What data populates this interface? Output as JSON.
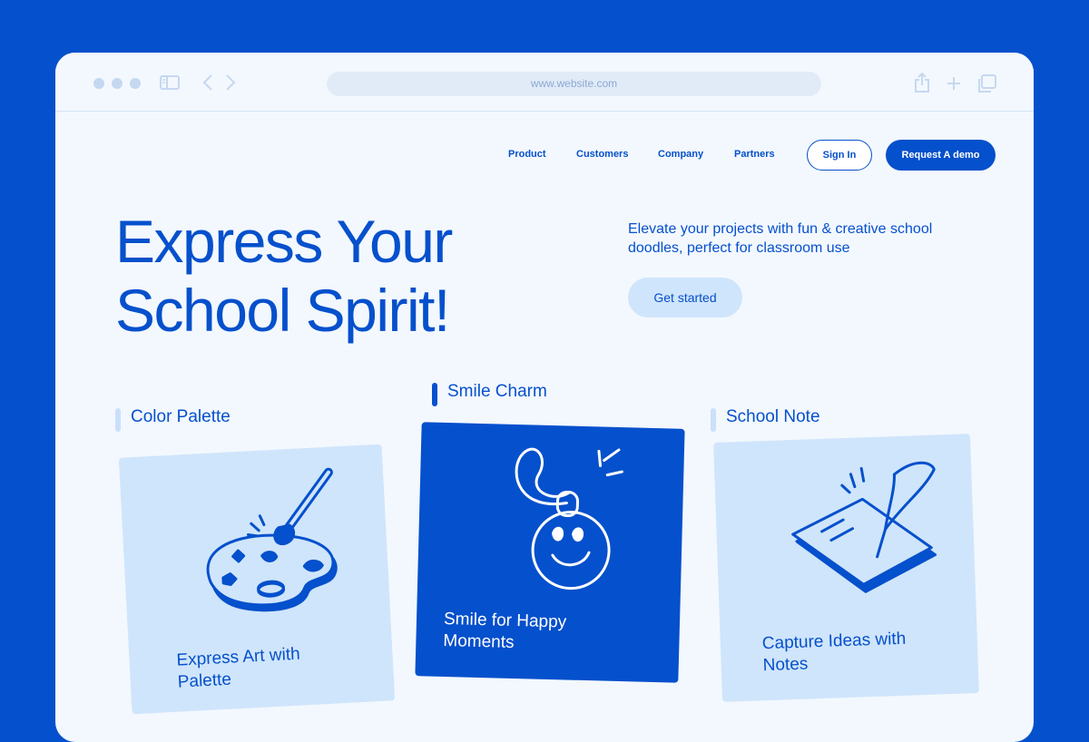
{
  "browser": {
    "url": "www.website.com"
  },
  "nav": {
    "links": [
      "Product",
      "Customers",
      "Company",
      "Partners"
    ],
    "sign_in": "Sign In",
    "request_demo": "Request A demo"
  },
  "hero": {
    "title_line1": "Express Your",
    "title_line2": "School Spirit!",
    "subtitle": "Elevate your projects with fun & creative school doodles, perfect for classroom use",
    "cta": "Get started"
  },
  "cards": [
    {
      "category": "Color Palette",
      "caption_line1": "Express Art with",
      "caption_line2": "Palette",
      "icon": "palette-icon"
    },
    {
      "category": "Smile Charm",
      "caption_line1": "Smile for Happy",
      "caption_line2": "Moments",
      "icon": "smile-charm-icon"
    },
    {
      "category": "School Note",
      "caption_line1": "Capture Ideas with",
      "caption_line2": "Notes",
      "icon": "notebook-quill-icon"
    }
  ],
  "colors": {
    "brand_blue": "#0550CC",
    "light_blue": "#CFE5FB",
    "page_bg": "#F3F8FE"
  }
}
